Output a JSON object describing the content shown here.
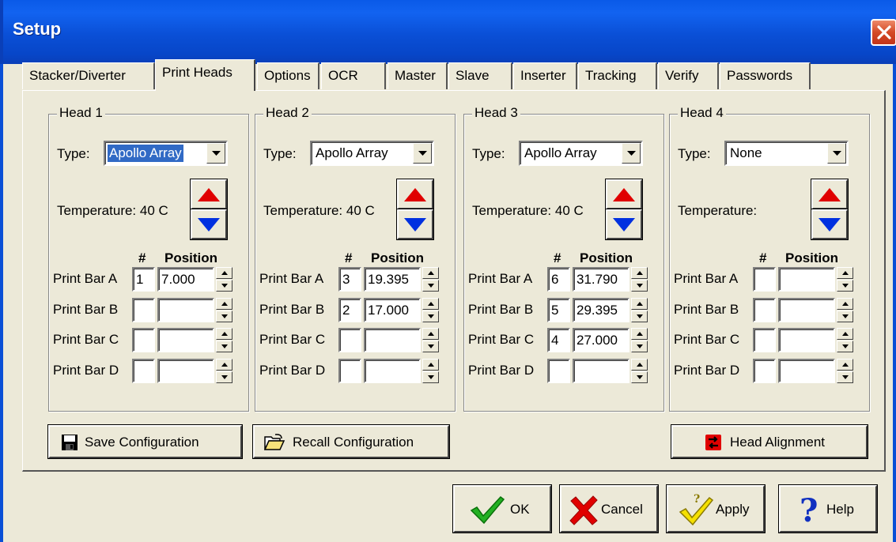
{
  "window": {
    "title": "Setup"
  },
  "tabs": [
    {
      "label": "Stacker/Diverter"
    },
    {
      "label": "Print Heads"
    },
    {
      "label": "Options"
    },
    {
      "label": "OCR"
    },
    {
      "label": "Master"
    },
    {
      "label": "Slave"
    },
    {
      "label": "Inserter"
    },
    {
      "label": "Tracking"
    },
    {
      "label": "Verify"
    },
    {
      "label": "Passwords"
    }
  ],
  "active_tab": "Print Heads",
  "labels": {
    "type": "Type:",
    "hash": "#",
    "position": "Position"
  },
  "heads": [
    {
      "title": "Head 1",
      "type": "Apollo Array",
      "type_selected": true,
      "temperature": "Temperature: 40 C",
      "bars": [
        {
          "label": "Print Bar A",
          "num": "1",
          "pos": "7.000"
        },
        {
          "label": "Print Bar B",
          "num": "",
          "pos": ""
        },
        {
          "label": "Print Bar C",
          "num": "",
          "pos": ""
        },
        {
          "label": "Print Bar D",
          "num": "",
          "pos": ""
        }
      ]
    },
    {
      "title": "Head 2",
      "type": "Apollo Array",
      "type_selected": false,
      "temperature": "Temperature: 40 C",
      "bars": [
        {
          "label": "Print Bar A",
          "num": "3",
          "pos": "19.395"
        },
        {
          "label": "Print Bar B",
          "num": "2",
          "pos": "17.000"
        },
        {
          "label": "Print Bar C",
          "num": "",
          "pos": ""
        },
        {
          "label": "Print Bar D",
          "num": "",
          "pos": ""
        }
      ]
    },
    {
      "title": "Head 3",
      "type": "Apollo Array",
      "type_selected": false,
      "temperature": "Temperature: 40 C",
      "bars": [
        {
          "label": "Print Bar A",
          "num": "6",
          "pos": "31.790"
        },
        {
          "label": "Print Bar B",
          "num": "5",
          "pos": "29.395"
        },
        {
          "label": "Print Bar C",
          "num": "4",
          "pos": "27.000"
        },
        {
          "label": "Print Bar D",
          "num": "",
          "pos": ""
        }
      ]
    },
    {
      "title": "Head 4",
      "type": "None",
      "type_selected": false,
      "temperature": "Temperature:",
      "bars": [
        {
          "label": "Print Bar A",
          "num": "",
          "pos": ""
        },
        {
          "label": "Print Bar B",
          "num": "",
          "pos": ""
        },
        {
          "label": "Print Bar C",
          "num": "",
          "pos": ""
        },
        {
          "label": "Print Bar D",
          "num": "",
          "pos": ""
        }
      ]
    }
  ],
  "panel_buttons": {
    "save": "Save Configuration",
    "recall": "Recall Configuration",
    "align": "Head Alignment"
  },
  "dialog_buttons": {
    "ok": "OK",
    "cancel": "Cancel",
    "apply": "Apply",
    "help": "Help"
  },
  "icons": {
    "close": "close-icon",
    "save": "floppy-disk-icon",
    "recall": "open-folder-icon",
    "align": "swap-arrows-icon",
    "ok": "green-checkmark-icon",
    "cancel": "red-x-icon",
    "apply": "yellow-check-icon",
    "help": "blue-question-icon"
  },
  "colors": {
    "title_bar": "#0a4fd6",
    "up_arrow": "#e00000",
    "down_arrow": "#0030e0",
    "selection": "#316ac5"
  }
}
